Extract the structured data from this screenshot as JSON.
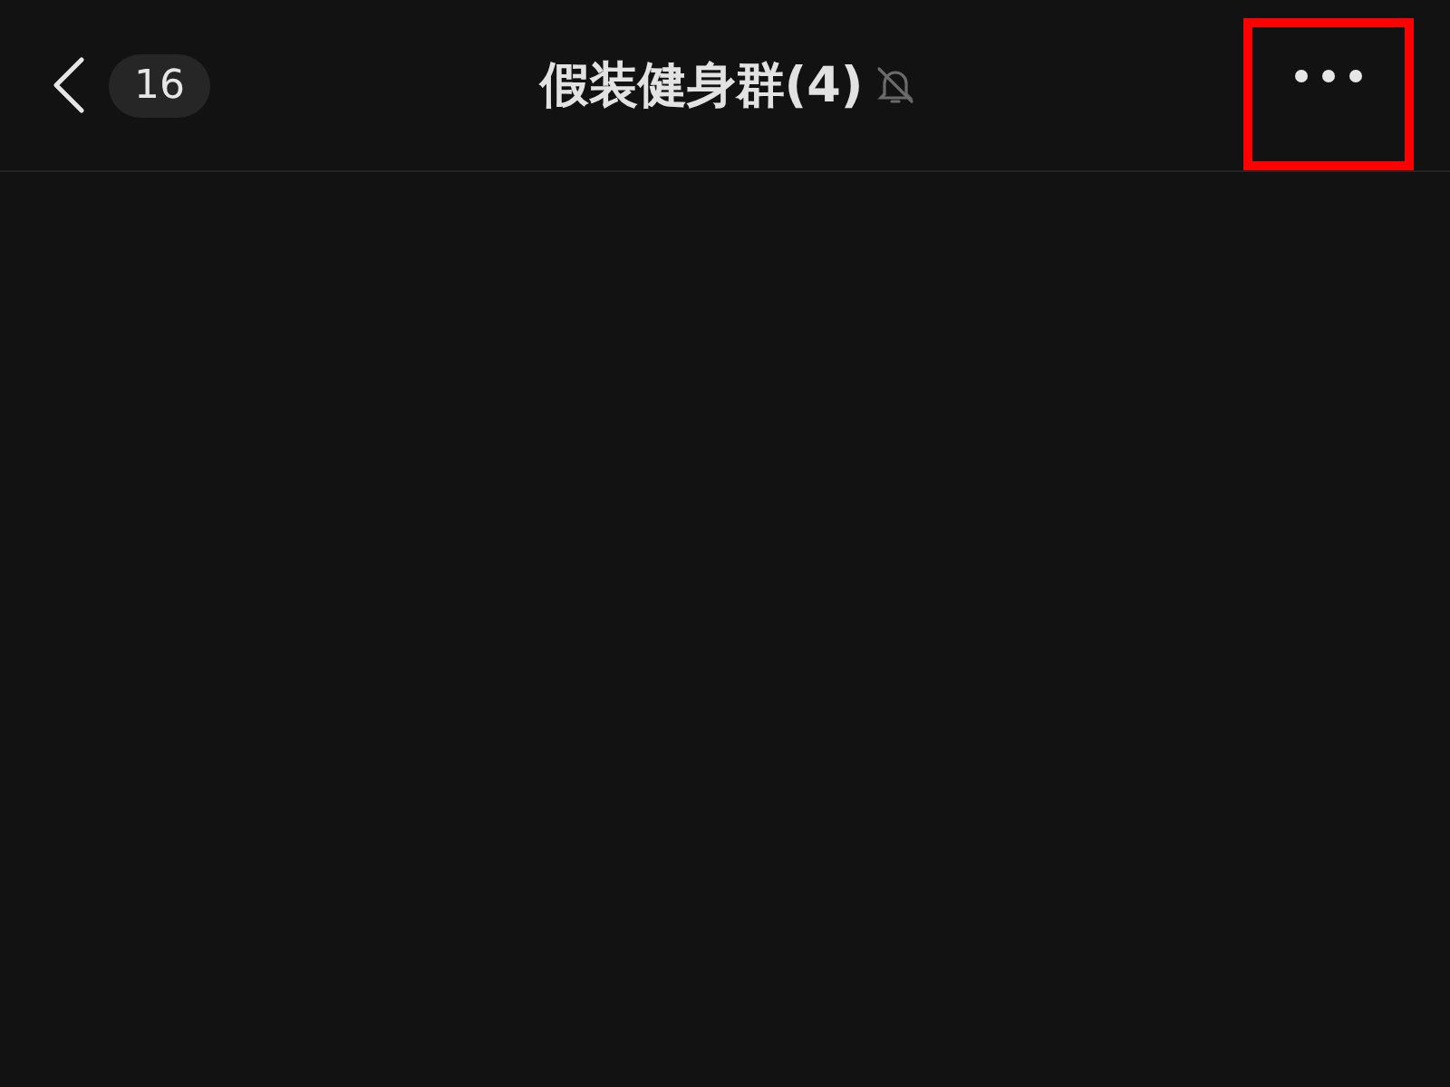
{
  "header": {
    "unread_count": "16",
    "title": "假装健身群(4)",
    "muted": true,
    "more_highlighted": true
  }
}
